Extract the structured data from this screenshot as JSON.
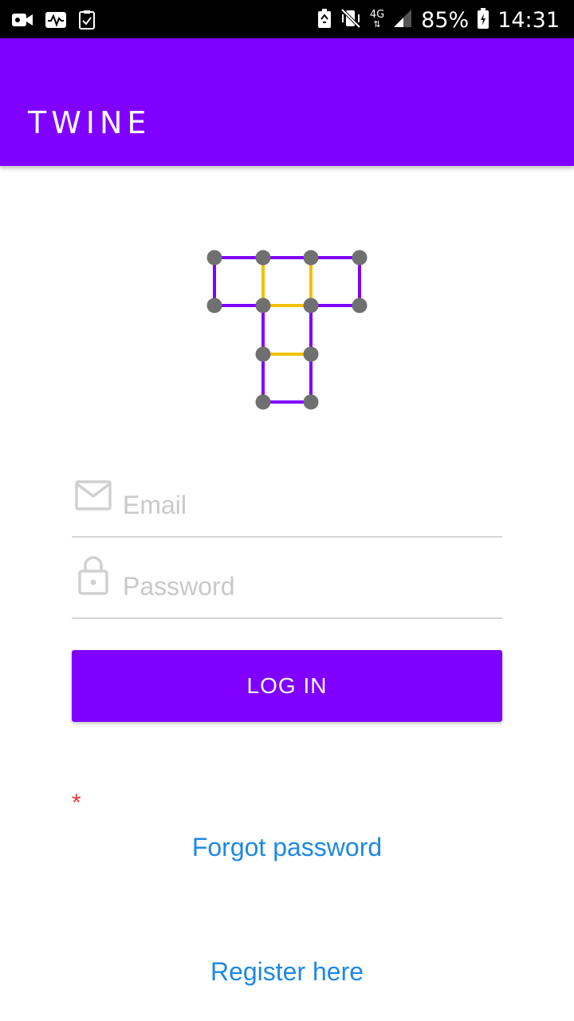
{
  "status_bar": {
    "battery": "85%",
    "time": "14:31",
    "network": "4G",
    "icons": [
      "video-camera-icon",
      "activity-monitor-icon",
      "clipboard-check-icon",
      "battery-saver-icon",
      "vibrate-mute-icon",
      "network-4g-icon",
      "signal-icon",
      "battery-icon"
    ]
  },
  "app_bar": {
    "title": "TWINE"
  },
  "logo": {
    "icon": "twine-logo-icon",
    "colors": {
      "stroke": "#7f00ff",
      "accent": "#f5c000",
      "node": "#707070"
    }
  },
  "form": {
    "email": {
      "placeholder": "Email",
      "value": "",
      "icon": "email-icon"
    },
    "password": {
      "placeholder": "Password",
      "value": "",
      "icon": "lock-icon"
    },
    "login_label": "LOG IN",
    "required_marker": "*"
  },
  "links": {
    "forgot_password": "Forgot password",
    "register": "Register here"
  },
  "colors": {
    "primary": "#7f00ff",
    "link": "#1e88e5",
    "error": "#e53935",
    "hint": "#c9c9c9"
  }
}
